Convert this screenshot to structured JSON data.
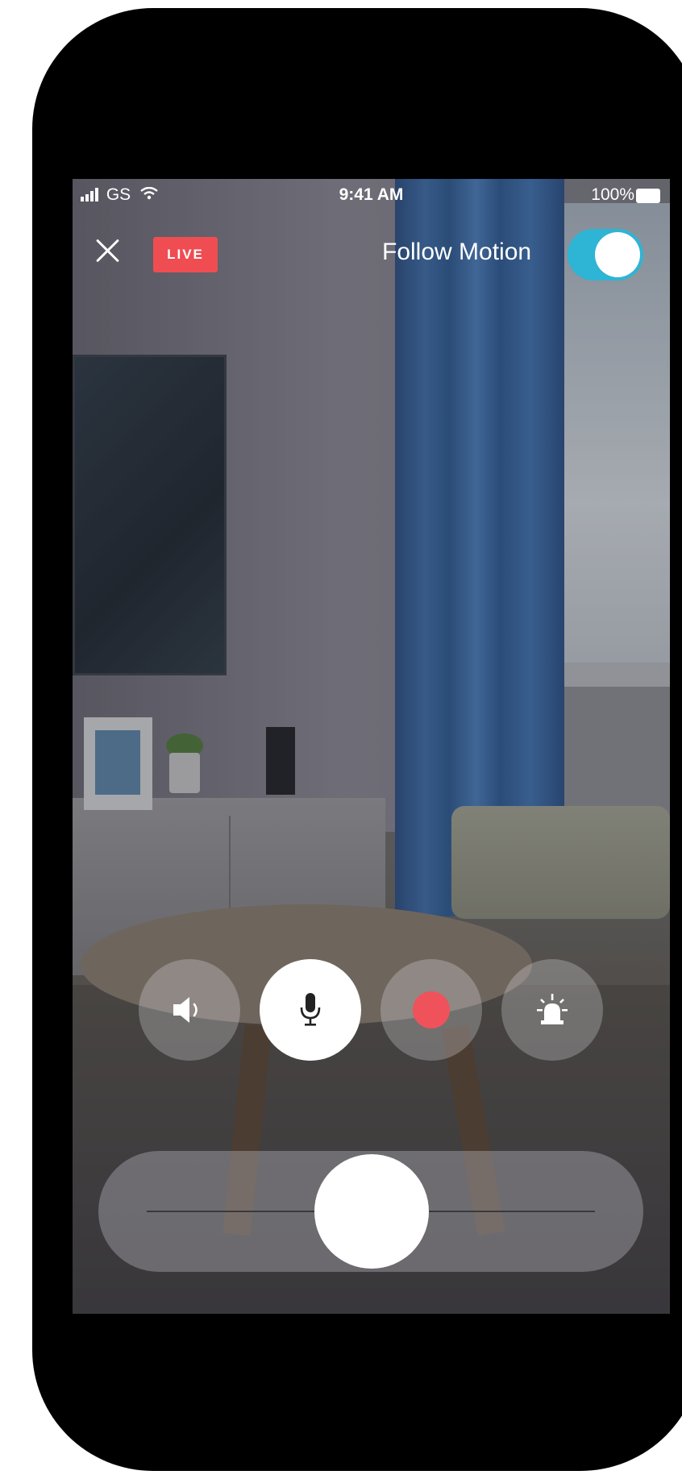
{
  "status_bar": {
    "carrier": "GS",
    "time": "9:41 AM",
    "battery": "100%"
  },
  "top_bar": {
    "live_badge": "LIVE",
    "follow_motion_label": "Follow Motion",
    "follow_motion_enabled": true
  },
  "controls": [
    {
      "name": "speaker",
      "icon": "speaker-icon",
      "active": false
    },
    {
      "name": "microphone",
      "icon": "microphone-icon",
      "active": true
    },
    {
      "name": "record",
      "icon": "record-icon",
      "active": false
    },
    {
      "name": "alarm",
      "icon": "alarm-siren-icon",
      "active": false
    }
  ],
  "pan_slider": {
    "value_fraction": 0.5
  },
  "colors": {
    "live": "#ef4d52",
    "toggle_on": "#2eb4d4",
    "record": "#f0525b"
  }
}
